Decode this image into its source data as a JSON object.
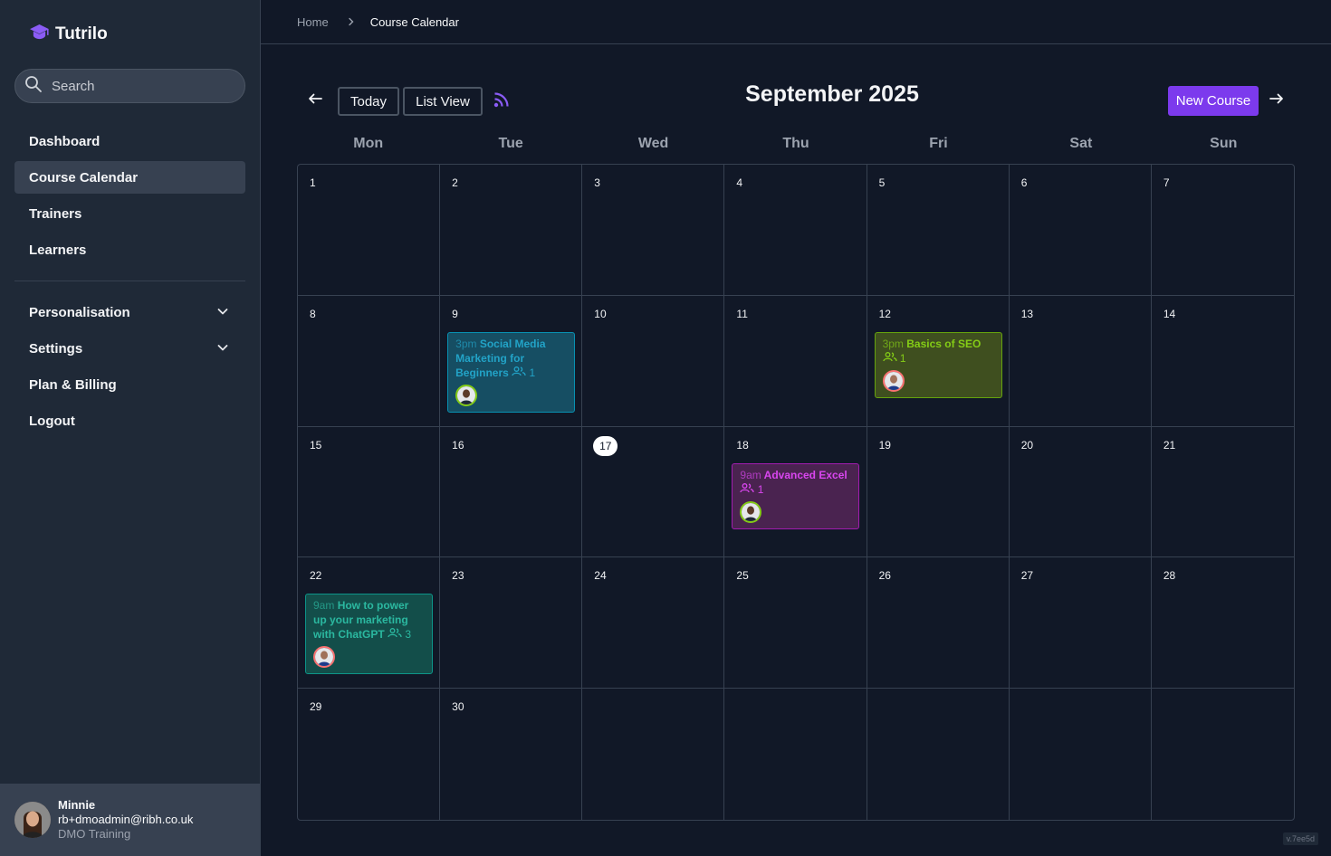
{
  "app": {
    "name": "Tutrilo",
    "version": "v.7ee5d"
  },
  "search": {
    "placeholder": "Search"
  },
  "sidebar": {
    "items": [
      {
        "label": "Dashboard"
      },
      {
        "label": "Course Calendar"
      },
      {
        "label": "Trainers"
      },
      {
        "label": "Learners"
      },
      {
        "label": "Personalisation"
      },
      {
        "label": "Settings"
      },
      {
        "label": "Plan & Billing"
      },
      {
        "label": "Logout"
      }
    ]
  },
  "user": {
    "name": "Minnie",
    "email": "rb+dmoadmin@ribh.co.uk",
    "org": "DMO Training"
  },
  "breadcrumb": {
    "home": "Home",
    "current": "Course Calendar"
  },
  "toolbar": {
    "today_label": "Today",
    "list_view_label": "List View",
    "new_course_label": "New Course"
  },
  "calendar": {
    "title": "September 2025",
    "weekdays": [
      "Mon",
      "Tue",
      "Wed",
      "Thu",
      "Fri",
      "Sat",
      "Sun"
    ],
    "days": [
      "1",
      "2",
      "3",
      "4",
      "5",
      "6",
      "7",
      "8",
      "9",
      "10",
      "11",
      "12",
      "13",
      "14",
      "15",
      "16",
      "17",
      "18",
      "19",
      "20",
      "21",
      "22",
      "23",
      "24",
      "25",
      "26",
      "27",
      "28",
      "29",
      "30",
      "",
      "",
      "",
      "",
      ""
    ],
    "today": "17",
    "events": [
      {
        "time": "3pm",
        "title": "Social Media Marketing for Beginners",
        "count": "1"
      },
      {
        "time": "3pm",
        "title": "Basics of SEO",
        "count": "1"
      },
      {
        "time": "9am",
        "title": "Advanced Excel",
        "count": "1"
      },
      {
        "time": "9am",
        "title": "How to power up your marketing with ChatGPT",
        "count": "3"
      }
    ]
  },
  "colors": {
    "accent": "#7c3aed",
    "background": "#111827",
    "sidebar": "#1f2937"
  }
}
